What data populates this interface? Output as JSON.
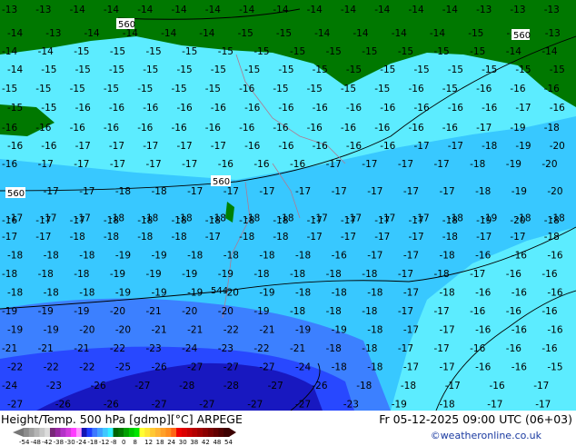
{
  "title": "Height/Temp. 500 hPa [gdmp][°C] ARPEGE",
  "datetime": "Fr 05-12-2025 09:00 UTC (06+03)",
  "credit": "©weatheronline.co.uk",
  "legend": {
    "ticks": [
      "-54",
      "-48",
      "-42",
      "-38",
      "-30",
      "-24",
      "-18",
      "-12",
      "-8",
      "0",
      "8",
      "12",
      "18",
      "24",
      "30",
      "38",
      "42",
      "48",
      "54"
    ],
    "colors": [
      "#8c8c8c",
      "#a0a0a0",
      "#b4b4b4",
      "#c8c8c8",
      "#dcdcdc",
      "#782878",
      "#9628a0",
      "#b432c8",
      "#d23cdc",
      "#ff3cff",
      "#ff96ff",
      "#1414b4",
      "#1e3cff",
      "#3c78ff",
      "#40a0ff",
      "#40c8ff",
      "#32f0ff",
      "#006400",
      "#007800",
      "#00a000",
      "#00c800",
      "#00e600",
      "#ffff32",
      "#ffe632",
      "#ffc832",
      "#ffb432",
      "#ffa028",
      "#ff8c1e",
      "#ff6414",
      "#f00000",
      "#dc0000",
      "#c80000",
      "#b40000",
      "#a00000",
      "#8c0000",
      "#780000",
      "#640000",
      "#500000",
      "#3c0000"
    ]
  },
  "colors": {
    "green": "#007800",
    "light_cyan": "#5cecff",
    "cyan": "#38c8ff",
    "blue": "#3c80ff",
    "deep_blue": "#2848ff",
    "darkest_blue": "#1818c0"
  },
  "height_labels": [
    "560",
    "560",
    "560",
    "560",
    "544"
  ],
  "temp_rows": [
    [
      "-13",
      "-13",
      "-14",
      "-14",
      "-14",
      "-14",
      "-14",
      "-14",
      "-14",
      "-14",
      "-14",
      "-14",
      "-14",
      "-14",
      "-13",
      "-13",
      "-13"
    ],
    [
      "-14",
      "-13",
      "-14",
      "-14",
      "-14",
      "-14",
      "-15",
      "-15",
      "-14",
      "-14",
      "-14",
      "-14",
      "-15",
      "-15",
      "-13"
    ],
    [
      "-14",
      "-14",
      "-15",
      "-15",
      "-15",
      "-15",
      "-15",
      "-15",
      "-15",
      "-15",
      "-15",
      "-15",
      "-15",
      "-15",
      "-14",
      "-14"
    ],
    [
      "-14",
      "-15",
      "-15",
      "-15",
      "-15",
      "-15",
      "-15",
      "-15",
      "-15",
      "-15",
      "-15",
      "-15",
      "-15",
      "-15",
      "-15",
      "-15",
      "-15"
    ],
    [
      "-15",
      "-15",
      "-15",
      "-15",
      "-15",
      "-15",
      "-15",
      "-16",
      "-15",
      "-15",
      "-15",
      "-15",
      "-16",
      "-15",
      "-16",
      "-16",
      "-16"
    ],
    [
      "-15",
      "-15",
      "-16",
      "-16",
      "-16",
      "-16",
      "-16",
      "-16",
      "-16",
      "-16",
      "-16",
      "-16",
      "-16",
      "-16",
      "-16",
      "-17",
      "-16"
    ],
    [
      "-16",
      "-16",
      "-16",
      "-16",
      "-16",
      "-16",
      "-16",
      "-16",
      "-16",
      "-16",
      "-16",
      "-16",
      "-16",
      "-16",
      "-17",
      "-19",
      "-18"
    ],
    [
      "-16",
      "-16",
      "-17",
      "-17",
      "-17",
      "-17",
      "-17",
      "-16",
      "-16",
      "-16",
      "-16",
      "-16",
      "-17",
      "-17",
      "-18",
      "-19",
      "-20"
    ],
    [
      "-16",
      "-17",
      "-17",
      "-17",
      "-17",
      "-17",
      "-16",
      "-16",
      "-16",
      "-17",
      "-17",
      "-17",
      "-17",
      "-18",
      "-19",
      "-20"
    ],
    [
      "-17",
      "-17",
      "-17",
      "-18",
      "-18",
      "-17",
      "-17",
      "-17",
      "-17",
      "-17",
      "-17",
      "-17",
      "-17",
      "-18",
      "-19",
      "-20"
    ],
    [
      "-16",
      "-17",
      "-17",
      "-18",
      "-18",
      "-18",
      "-18",
      "-18",
      "-18",
      "-17",
      "-17",
      "-17",
      "-17",
      "-18",
      "-19",
      "-20",
      "-18"
    ],
    [
      "-17",
      "-17",
      "-17",
      "-18",
      "-18",
      "-18",
      "-18",
      "-18",
      "-18",
      "-17",
      "-17",
      "-17",
      "-17",
      "-18",
      "-19",
      "-18",
      "-18"
    ],
    [
      "-17",
      "-17",
      "-18",
      "-18",
      "-18",
      "-18",
      "-17",
      "-18",
      "-18",
      "-17",
      "-17",
      "-17",
      "-17",
      "-18",
      "-17",
      "-17",
      "-18"
    ],
    [
      "-18",
      "-18",
      "-18",
      "-19",
      "-19",
      "-18",
      "-18",
      "-18",
      "-18",
      "-16",
      "-17",
      "-17",
      "-18",
      "-16",
      "-16",
      "-16"
    ],
    [
      "-18",
      "-18",
      "-18",
      "-19",
      "-19",
      "-19",
      "-19",
      "-18",
      "-18",
      "-18",
      "-18",
      "-17",
      "-18",
      "-17",
      "-16",
      "-16"
    ],
    [
      "-18",
      "-18",
      "-18",
      "-19",
      "-19",
      "-19",
      "-20",
      "-19",
      "-18",
      "-18",
      "-18",
      "-17",
      "-18",
      "-16",
      "-16",
      "-16"
    ],
    [
      "-19",
      "-19",
      "-19",
      "-20",
      "-21",
      "-20",
      "-20",
      "-19",
      "-18",
      "-18",
      "-18",
      "-17",
      "-17",
      "-16",
      "-16",
      "-16"
    ],
    [
      "-19",
      "-19",
      "-20",
      "-20",
      "-21",
      "-21",
      "-22",
      "-21",
      "-19",
      "-19",
      "-18",
      "-17",
      "-17",
      "-16",
      "-16",
      "-16"
    ],
    [
      "-21",
      "-21",
      "-21",
      "-22",
      "-23",
      "-24",
      "-23",
      "-22",
      "-21",
      "-18",
      "-18",
      "-17",
      "-17",
      "-16",
      "-16",
      "-16"
    ],
    [
      "-22",
      "-22",
      "-22",
      "-25",
      "-26",
      "-27",
      "-27",
      "-27",
      "-24",
      "-18",
      "-18",
      "-17",
      "-17",
      "-16",
      "-16",
      "-15"
    ],
    [
      "-24",
      "-23",
      "-26",
      "-27",
      "-28",
      "-28",
      "-27",
      "-26",
      "-18",
      "-18",
      "-17",
      "-16",
      "-17"
    ],
    [
      "-27",
      "-26",
      "-26",
      "-27",
      "-27",
      "-27",
      "-27",
      "-23",
      "-19",
      "-18",
      "-17",
      "-17"
    ]
  ]
}
